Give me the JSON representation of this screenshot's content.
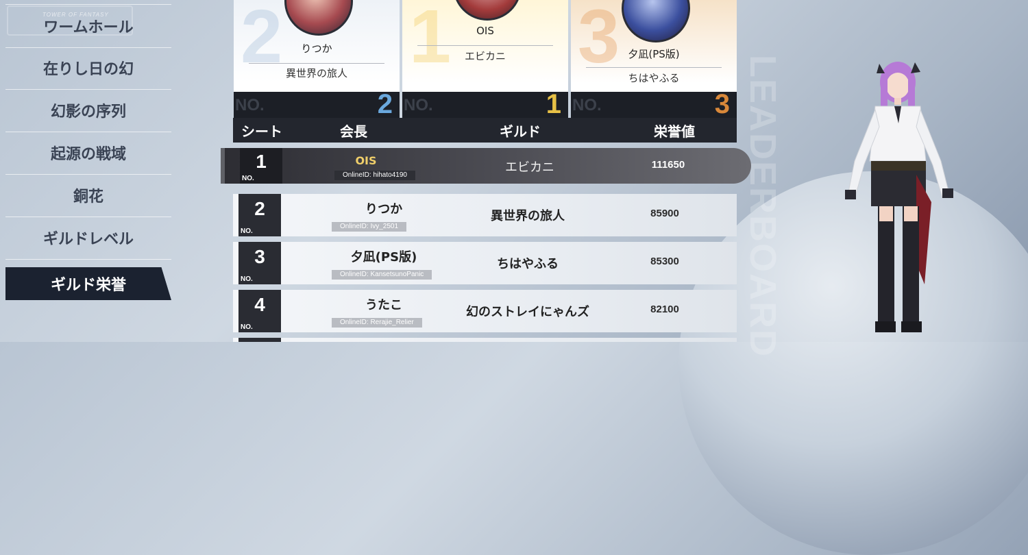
{
  "backdrop": {
    "watermark": "LEADERBOARD"
  },
  "sidebar": {
    "logo_text": "TOWER OF FANTASY",
    "items": [
      {
        "label": "ワームホール"
      },
      {
        "label": "在りし日の幻"
      },
      {
        "label": "幻影の序列"
      },
      {
        "label": "起源の戦域"
      },
      {
        "label": "銅花"
      },
      {
        "label": "ギルドレベル"
      },
      {
        "label": "ギルド栄誉"
      }
    ],
    "active_item": "ギルド栄誉"
  },
  "podium": [
    {
      "rank": "2",
      "name": "りつか",
      "guild": "異世界の旅人",
      "no_label": "NO.",
      "color": "#6aa8dd"
    },
    {
      "rank": "1",
      "name": "OIS",
      "guild": "エビカニ",
      "no_label": "NO.",
      "color": "#e7c046"
    },
    {
      "rank": "3",
      "name": "夕凪(PS版)",
      "guild": "ちはやふる",
      "no_label": "NO.",
      "color": "#d9883a"
    }
  ],
  "table": {
    "headers": {
      "seat": "シート",
      "leader": "会長",
      "guild": "ギルド",
      "score": "栄誉値"
    },
    "rows": [
      {
        "rank": "1",
        "no_label": "NO.",
        "leader": "OIS",
        "online_id": "OnlineID: hihato4190",
        "guild": "エビカニ",
        "score": "111650"
      },
      {
        "rank": "2",
        "no_label": "NO.",
        "leader": "りつか",
        "online_id": "OnlineID: Ivy_2501",
        "guild": "異世界の旅人",
        "score": "85900"
      },
      {
        "rank": "3",
        "no_label": "NO.",
        "leader": "夕凪(PS版)",
        "online_id": "OnlineID: KansetsunoPanic",
        "guild": "ちはやふる",
        "score": "85300"
      },
      {
        "rank": "4",
        "no_label": "NO.",
        "leader": "うたこ",
        "online_id": "OnlineID: Rerajie_Relier",
        "guild": "幻のストレイにゃんズ",
        "score": "82100"
      }
    ]
  },
  "colors": {
    "gold": "#f0cf6a",
    "dark_panel": "#23262e"
  }
}
